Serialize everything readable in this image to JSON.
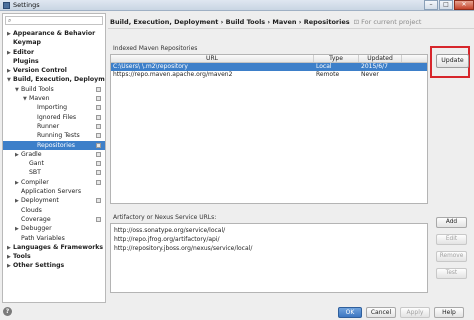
{
  "window": {
    "title": "Settings",
    "controls": {
      "minimize": "–",
      "maximize": "□",
      "close": "✕"
    }
  },
  "tree": {
    "search_icon": "search-icon",
    "items": [
      {
        "label": "Appearance & Behavior",
        "arrow": "▶",
        "bold": true
      },
      {
        "label": "Keymap",
        "arrow": "",
        "bold": true
      },
      {
        "label": "Editor",
        "arrow": "▶",
        "bold": true
      },
      {
        "label": "Plugins",
        "arrow": "",
        "bold": true
      },
      {
        "label": "Version Control",
        "arrow": "▶",
        "bold": true
      },
      {
        "label": "Build, Execution, Deployment",
        "arrow": "▼",
        "bold": true
      },
      {
        "label": "Build Tools",
        "arrow": "▼"
      },
      {
        "label": "Maven",
        "arrow": "▼"
      },
      {
        "label": "Importing",
        "arrow": ""
      },
      {
        "label": "Ignored Files",
        "arrow": ""
      },
      {
        "label": "Runner",
        "arrow": ""
      },
      {
        "label": "Running Tests",
        "arrow": ""
      },
      {
        "label": "Repositories",
        "arrow": "",
        "selected": true
      },
      {
        "label": "Gradle",
        "arrow": "▶"
      },
      {
        "label": "Gant",
        "arrow": ""
      },
      {
        "label": "SBT",
        "arrow": ""
      },
      {
        "label": "Compiler",
        "arrow": "▶"
      },
      {
        "label": "Application Servers",
        "arrow": ""
      },
      {
        "label": "Deployment",
        "arrow": "▶"
      },
      {
        "label": "Clouds",
        "arrow": ""
      },
      {
        "label": "Coverage",
        "arrow": ""
      },
      {
        "label": "Debugger",
        "arrow": "▶"
      },
      {
        "label": "Path Variables",
        "arrow": ""
      },
      {
        "label": "Languages & Frameworks",
        "arrow": "▶",
        "bold": true
      },
      {
        "label": "Tools",
        "arrow": "▶",
        "bold": true
      },
      {
        "label": "Other Settings",
        "arrow": "▶",
        "bold": true
      }
    ]
  },
  "breadcrumb": {
    "path": "Build, Execution, Deployment › Build Tools › Maven › Repositories",
    "hint": "For current project"
  },
  "indexed": {
    "label": "Indexed Maven Repositories",
    "headers": [
      "URL",
      "Type",
      "Updated"
    ],
    "rows": [
      {
        "url": "C:\\Users\\          \\.m2\\repository",
        "type": "Local",
        "updated": "2015/6/7"
      },
      {
        "url": "https://repo.maven.apache.org/maven2",
        "type": "Remote",
        "updated": "Never"
      }
    ],
    "update_button": "Update"
  },
  "artifactory": {
    "label": "Artifactory or Nexus Service URLs:",
    "items": [
      "http://oss.sonatype.org/service/local/",
      "http://repo.jfrog.org/artifactory/api/",
      "http://repository.jboss.org/nexus/service/local/"
    ],
    "buttons": {
      "add": "Add",
      "edit": "Edit",
      "remove": "Remove",
      "test": "Test"
    }
  },
  "footer": {
    "help": "?",
    "ok": "OK",
    "cancel": "Cancel",
    "apply": "Apply",
    "help_button": "Help"
  },
  "colors": {
    "selection": "#3d7fc9",
    "highlight": "#d7262b"
  }
}
